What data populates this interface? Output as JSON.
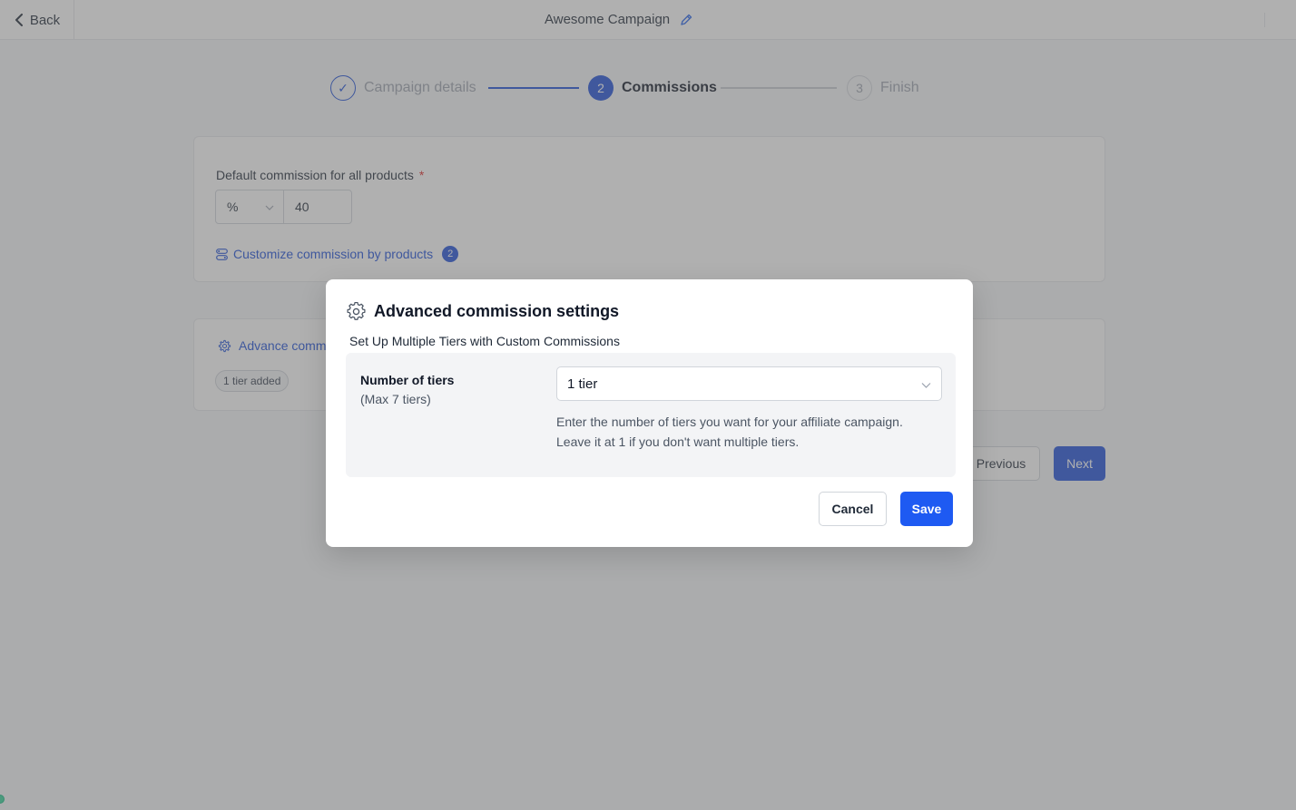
{
  "topbar": {
    "back_label": "Back",
    "campaign_title": "Awesome Campaign"
  },
  "stepper": {
    "steps": [
      {
        "number": "✓",
        "label": "Campaign details",
        "state": "completed"
      },
      {
        "number": "2",
        "label": "Commissions",
        "state": "active"
      },
      {
        "number": "3",
        "label": "Finish",
        "state": "upcoming"
      }
    ]
  },
  "default_commission": {
    "label": "Default commission for all products",
    "required_mark": "*",
    "unit": "%",
    "value": "40",
    "customize_link": "Customize commission by products",
    "customize_count": "2"
  },
  "advanced_card": {
    "link_label": "Advance comm",
    "tier_badge": "1 tier added"
  },
  "navigation": {
    "previous_label": "Previous",
    "next_label": "Next"
  },
  "modal": {
    "title": "Advanced commission settings",
    "subtitle": "Set Up Multiple Tiers with Custom Commissions",
    "tiers_label": "Number of tiers",
    "tiers_hint": "(Max 7 tiers)",
    "tiers_value": "1 tier",
    "help_line1": "Enter the number of tiers you want for your affiliate campaign.",
    "help_line2": "Leave it at 1 if you don't want multiple tiers.",
    "cancel_label": "Cancel",
    "save_label": "Save"
  },
  "colors": {
    "primary": "#1e4fd8",
    "save_button": "#1e5af2",
    "required": "#dc2626",
    "overlay": "rgba(98,98,98,0.5)"
  },
  "icons": {
    "back": "chevron-left-icon",
    "edit": "pencil-icon",
    "customize": "sliders-icon",
    "advanced": "gear-icon",
    "dropdown": "chevron-down-icon"
  }
}
